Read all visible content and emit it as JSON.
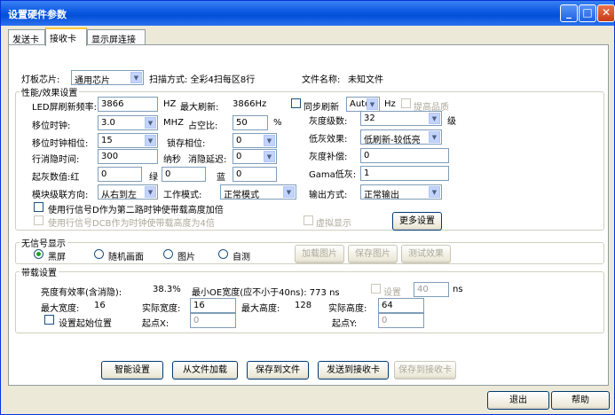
{
  "window": {
    "title": "设置硬件参数"
  },
  "tabs": [
    "发送卡",
    "接收卡",
    "显示屏连接"
  ],
  "top": {
    "chip_label": "灯板芯片:",
    "chip_value": "通用芯片",
    "scan_label": "扫描方式: 全彩4扫每区8行",
    "file_label": "文件名称:",
    "file_value": "未知文件"
  },
  "perf": {
    "title": "性能/效果设置",
    "refresh_label": "LED屏刷新频率:",
    "refresh_value": "3866",
    "hz_unit": "HZ",
    "max_refresh_label": "最大刷新:",
    "max_refresh_value": "3866Hz",
    "sync_label": "同步刷新",
    "sync_value": "Auto",
    "hz2": "Hz",
    "improve_label": "提高品质",
    "shift_clock_label": "移位时钟:",
    "shift_clock_value": "3.0",
    "mhz": "MHZ",
    "duty_label": "占空比:",
    "duty_value": "50",
    "percent": "%",
    "gray_levels_label": "灰度级数:",
    "gray_levels_value": "32",
    "level_unit": "级",
    "shift_phase_label": "移位时钟相位:",
    "shift_phase_value": "15",
    "latch_phase_label": "锁存相位:",
    "latch_phase_value": "0",
    "low_gray_label": "低灰效果:",
    "low_gray_value": "低刷新-较低亮",
    "blank_time_label": "行消隐时间:",
    "blank_time_value": "300",
    "ns_unit": "纳秒",
    "blank_delay_label": "消隐延迟:",
    "blank_delay_value": "0",
    "gray_comp_label": "灰度补偿:",
    "gray_comp_value": "0",
    "start_gray_label": "起灰数值:红",
    "red_value": "0",
    "green_label": "绿",
    "green_value": "0",
    "blue_label": "蓝",
    "blue_value": "0",
    "gamma_label": "Gama低灰:",
    "gamma_value": "1",
    "cascade_label": "模块级联方向:",
    "cascade_value": "从右到左",
    "work_mode_label": "工作模式:",
    "work_mode_value": "正常模式",
    "output_label": "输出方式:",
    "output_value": "正常输出",
    "use_d_label": "使用行信号D作为第二路时钟使带载高度加倍",
    "use_dcb_label": "使用行信号DCB作为时钟使带载高度为4倍",
    "virtual_label": "虚拟显示",
    "more_button": "更多设置"
  },
  "nosignal": {
    "title": "无信号显示",
    "options": [
      "黑屏",
      "随机画面",
      "图片",
      "自测"
    ],
    "load_image": "加载图片",
    "save_image": "保存图片",
    "test_effect": "测试效果"
  },
  "load": {
    "title": "带载设置",
    "efficiency_label": "亮度有效率(含消隐):",
    "efficiency_value": "38.3%",
    "min_oe_label": "最小OE宽度(应不小于40ns): 773 ns",
    "set_label": "设置",
    "set_value": "40",
    "ns": "ns",
    "max_width_label": "最大宽度:",
    "max_width_value": "16",
    "actual_width_label": "实际宽度:",
    "actual_width_value": "16",
    "max_height_label": "最大高度:",
    "max_height_value": "128",
    "actual_height_label": "实际高度:",
    "actual_height_value": "64",
    "set_start_label": "设置起始位置",
    "start_x_label": "起点X:",
    "start_x_value": "0",
    "start_y_label": "起点Y:",
    "start_y_value": "0"
  },
  "actions": [
    "智能设置",
    "从文件加载",
    "保存到文件",
    "发送到接收卡",
    "保存到接收卡"
  ],
  "footer": {
    "exit": "退出",
    "help": "帮助"
  }
}
